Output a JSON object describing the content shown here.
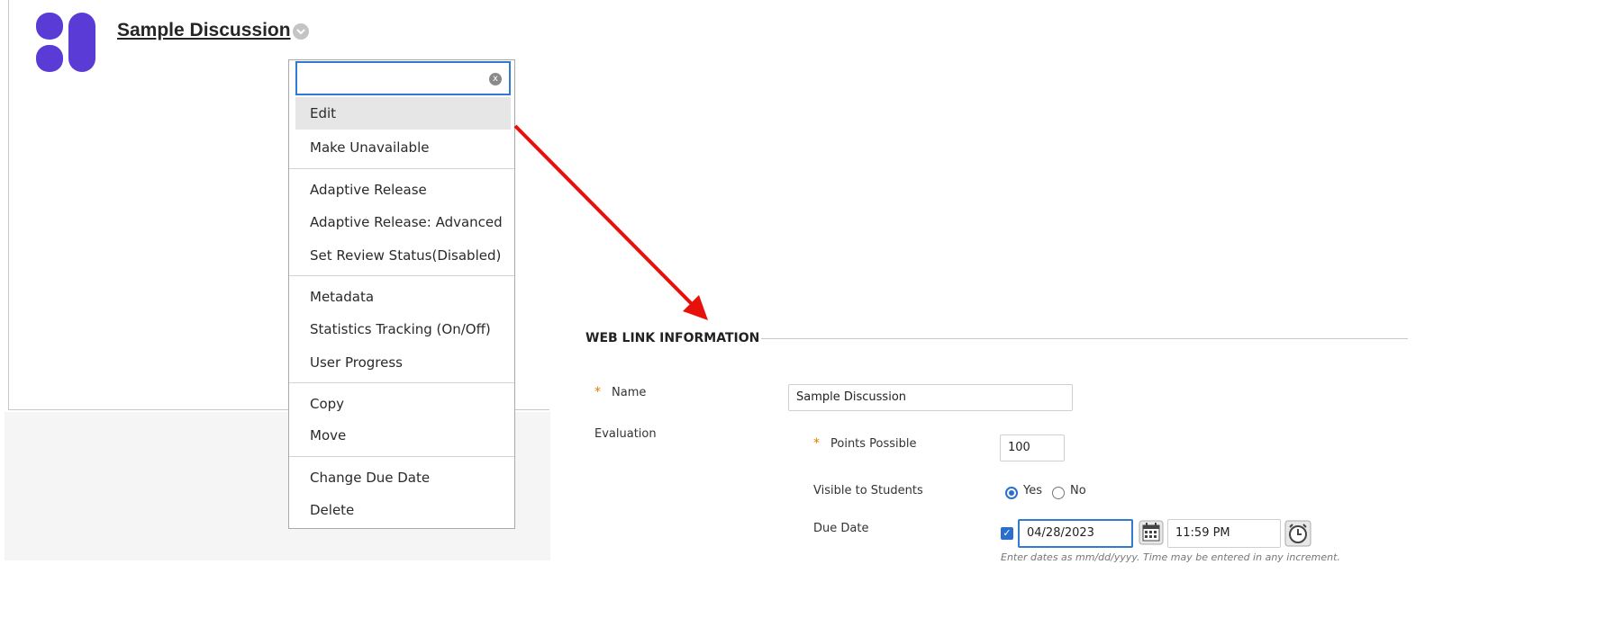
{
  "item": {
    "title": "Sample Discussion"
  },
  "menu": {
    "search_value": "",
    "clear_icon": "x",
    "items": [
      "Edit",
      "Make Unavailable",
      "Adaptive Release",
      "Adaptive Release: Advanced",
      "Set Review Status(Disabled)",
      "Metadata",
      "Statistics Tracking (On/Off)",
      "User Progress",
      "Copy",
      "Move",
      "Change Due Date",
      "Delete"
    ]
  },
  "form": {
    "section_title": "WEB LINK INFORMATION",
    "required_marker": "*",
    "name_label": "Name",
    "name_value": "Sample Discussion",
    "evaluation_label": "Evaluation",
    "points_label": "Points Possible",
    "points_value": "100",
    "visible_label": "Visible to Students",
    "visible_yes": "Yes",
    "visible_no": "No",
    "due_label": "Due Date",
    "due_date": "04/28/2023",
    "due_time": "11:59 PM",
    "hint": "Enter dates as mm/dd/yyyy. Time may be entered in any increment."
  },
  "colors": {
    "accent": "#2f7bd0",
    "arrow": "#e8100b",
    "logo": "#5a3bd6",
    "required": "#e07b00"
  }
}
